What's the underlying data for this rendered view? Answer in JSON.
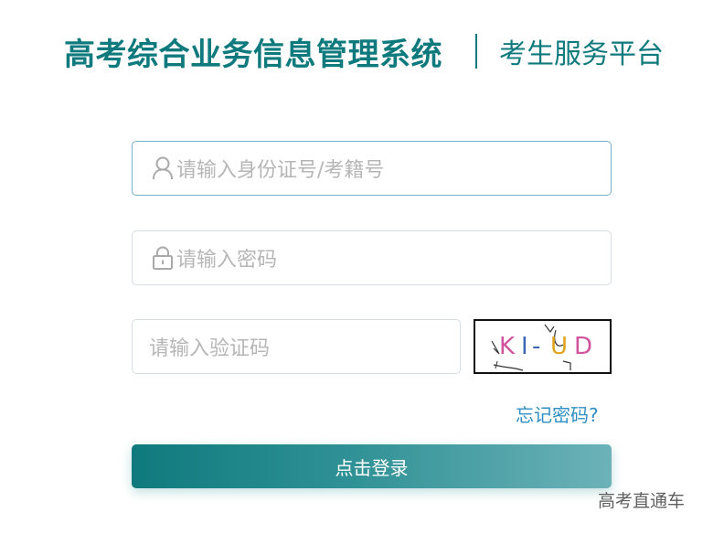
{
  "header": {
    "title": "高考综合业务信息管理系统",
    "subtitle": "考生服务平台"
  },
  "form": {
    "id_field": {
      "placeholder": "请输入身份证号/考籍号",
      "icon": "user-icon"
    },
    "password_field": {
      "placeholder": "请输入密码",
      "icon": "lock-icon"
    },
    "captcha_field": {
      "placeholder": "请输入验证码"
    },
    "captcha_image": {
      "text": "KI-UD"
    },
    "forgot_link": "忘记密码?",
    "login_button": "点击登录"
  },
  "watermark": "高考直通车",
  "colors": {
    "brand": "#0f7a7d",
    "link": "#2f8fc4",
    "placeholder": "#b6b6b6",
    "active_border": "#76b2c9"
  }
}
